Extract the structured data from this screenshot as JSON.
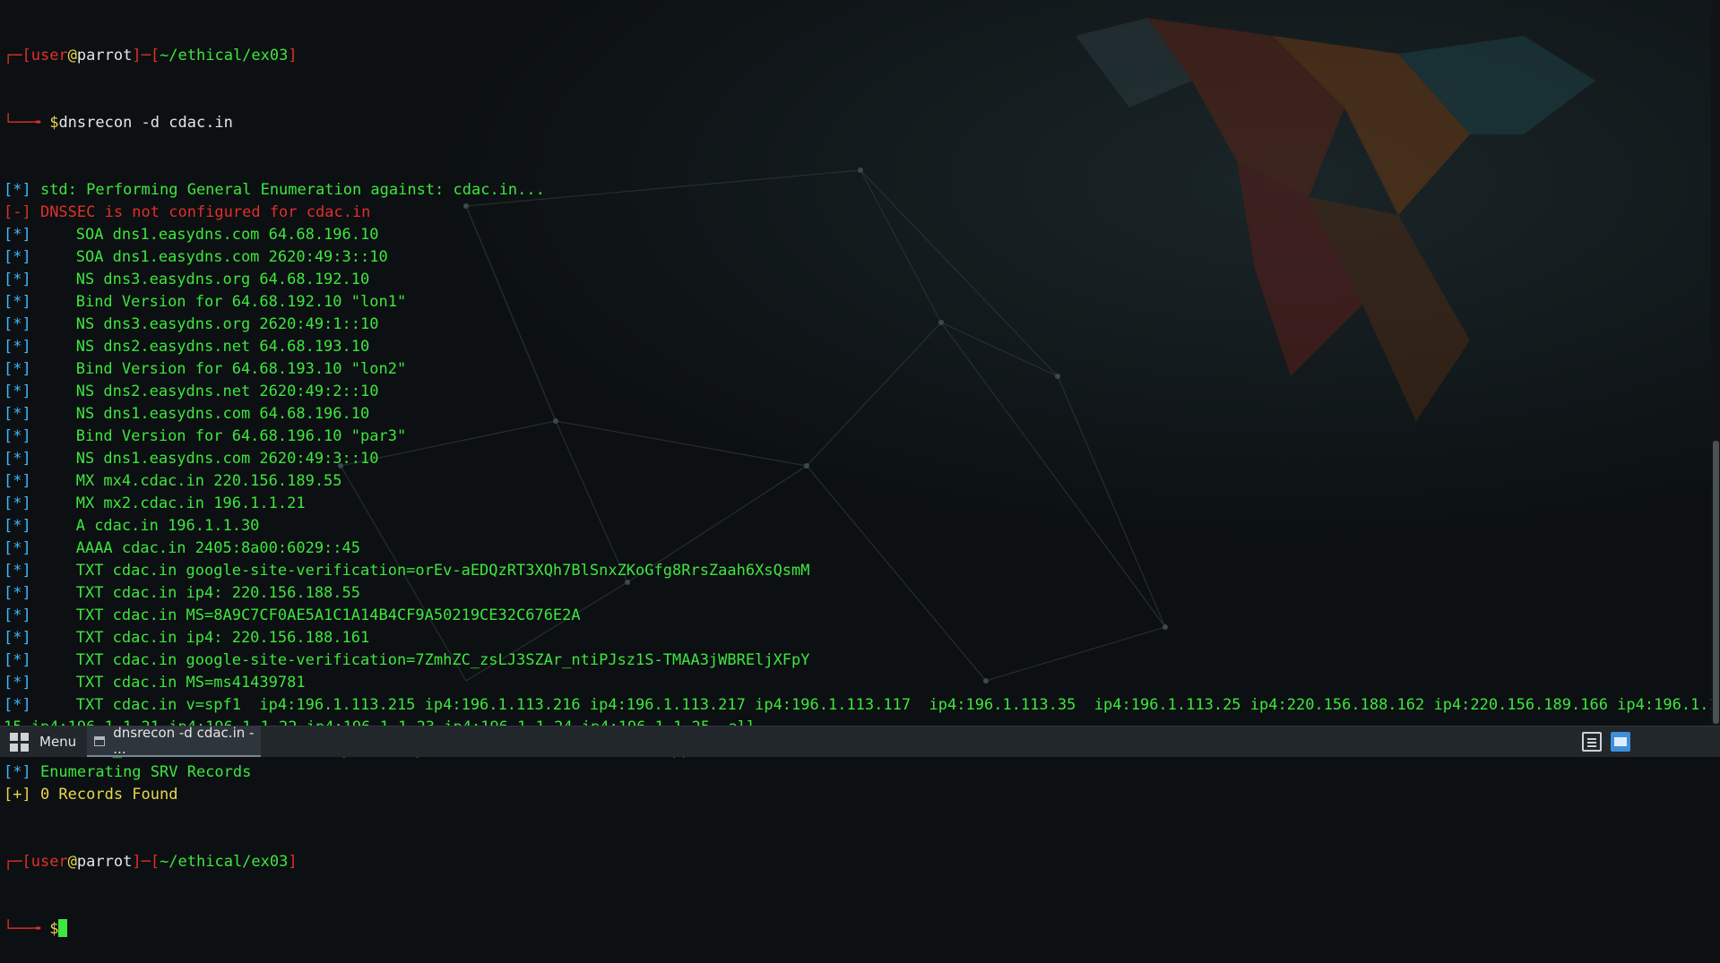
{
  "terminal": {
    "user": "user",
    "at": "@",
    "host": "parrot",
    "path": "~/ethical/ex03",
    "dollar": "$",
    "command": "dnsrecon -d cdac.in",
    "tags": {
      "ok": "[*]",
      "err": "[-]",
      "plus": "[+]"
    },
    "lines": [
      {
        "tag": "ok",
        "indent": false,
        "text": " std: Performing General Enumeration against: cdac.in..."
      },
      {
        "tag": "err",
        "indent": false,
        "text": " DNSSEC is not configured for cdac.in"
      },
      {
        "tag": "ok",
        "indent": true,
        "text": "SOA dns1.easydns.com 64.68.196.10"
      },
      {
        "tag": "ok",
        "indent": true,
        "text": "SOA dns1.easydns.com 2620:49:3::10"
      },
      {
        "tag": "ok",
        "indent": true,
        "text": "NS dns3.easydns.org 64.68.192.10"
      },
      {
        "tag": "ok",
        "indent": true,
        "text": "Bind Version for 64.68.192.10 \"lon1\""
      },
      {
        "tag": "ok",
        "indent": true,
        "text": "NS dns3.easydns.org 2620:49:1::10"
      },
      {
        "tag": "ok",
        "indent": true,
        "text": "NS dns2.easydns.net 64.68.193.10"
      },
      {
        "tag": "ok",
        "indent": true,
        "text": "Bind Version for 64.68.193.10 \"lon2\""
      },
      {
        "tag": "ok",
        "indent": true,
        "text": "NS dns2.easydns.net 2620:49:2::10"
      },
      {
        "tag": "ok",
        "indent": true,
        "text": "NS dns1.easydns.com 64.68.196.10"
      },
      {
        "tag": "ok",
        "indent": true,
        "text": "Bind Version for 64.68.196.10 \"par3\""
      },
      {
        "tag": "ok",
        "indent": true,
        "text": "NS dns1.easydns.com 2620:49:3::10"
      },
      {
        "tag": "ok",
        "indent": true,
        "text": "MX mx4.cdac.in 220.156.189.55"
      },
      {
        "tag": "ok",
        "indent": true,
        "text": "MX mx2.cdac.in 196.1.1.21"
      },
      {
        "tag": "ok",
        "indent": true,
        "text": "A cdac.in 196.1.1.30"
      },
      {
        "tag": "ok",
        "indent": true,
        "text": "AAAA cdac.in 2405:8a00:6029::45"
      },
      {
        "tag": "ok",
        "indent": true,
        "text": "TXT cdac.in google-site-verification=orEv-aEDQzRT3XQh7BlSnxZKoGfg8RrsZaah6XsQsmM"
      },
      {
        "tag": "ok",
        "indent": true,
        "text": "TXT cdac.in ip4: 220.156.188.55"
      },
      {
        "tag": "ok",
        "indent": true,
        "text": "TXT cdac.in MS=8A9C7CF0AE5A1C1A14B4CF9A50219CE32C676E2A"
      },
      {
        "tag": "ok",
        "indent": true,
        "text": "TXT cdac.in ip4: 220.156.188.161"
      },
      {
        "tag": "ok",
        "indent": true,
        "text": "TXT cdac.in google-site-verification=7ZmhZC_zsLJ3SZAr_ntiPJsz1S-TMAA3jWBREljXFpY"
      },
      {
        "tag": "ok",
        "indent": true,
        "text": "TXT cdac.in MS=ms41439781"
      },
      {
        "tag": "ok",
        "indent": true,
        "text": "TXT cdac.in v=spf1  ip4:196.1.113.215 ip4:196.1.113.216 ip4:196.1.113.217 ip4:196.1.113.117  ip4:196.1.113.35  ip4:196.1.113.25 ip4:220.156.188.162 ip4:220.156.189.166 ip4:196.1.1.2"
      },
      {
        "tag": "none",
        "indent": false,
        "text": "15 ip4:196.1.1.21 ip4:196.1.1.22 ip4:196.1.1.23 ip4:196.1.1.24 ip4:196.1.1.25 -all"
      },
      {
        "tag": "ok",
        "indent": true,
        "text": "TXT _dmarc.cdac.in v=DMARC1; p=none; pct=100; rua=mailto:dmarc-support@cdac.in;"
      },
      {
        "tag": "ok",
        "indent": false,
        "text": " Enumerating SRV Records"
      },
      {
        "tag": "plus",
        "indent": false,
        "text": " 0 Records Found"
      }
    ]
  },
  "taskbar": {
    "menu_label": "Menu",
    "task_label": "dnsrecon -d cdac.in - ...",
    "icons": {
      "menu": "app-grid-icon",
      "task": "terminal-window-icon",
      "tray1": "keyboard-icon",
      "tray2": "screen-icon"
    }
  },
  "colors": {
    "background": "#0c1012",
    "terminal_text": "#3ee63e",
    "prompt_red": "#e0302b",
    "tag_blue": "#41b4ff",
    "taskbar": "#22272c"
  }
}
